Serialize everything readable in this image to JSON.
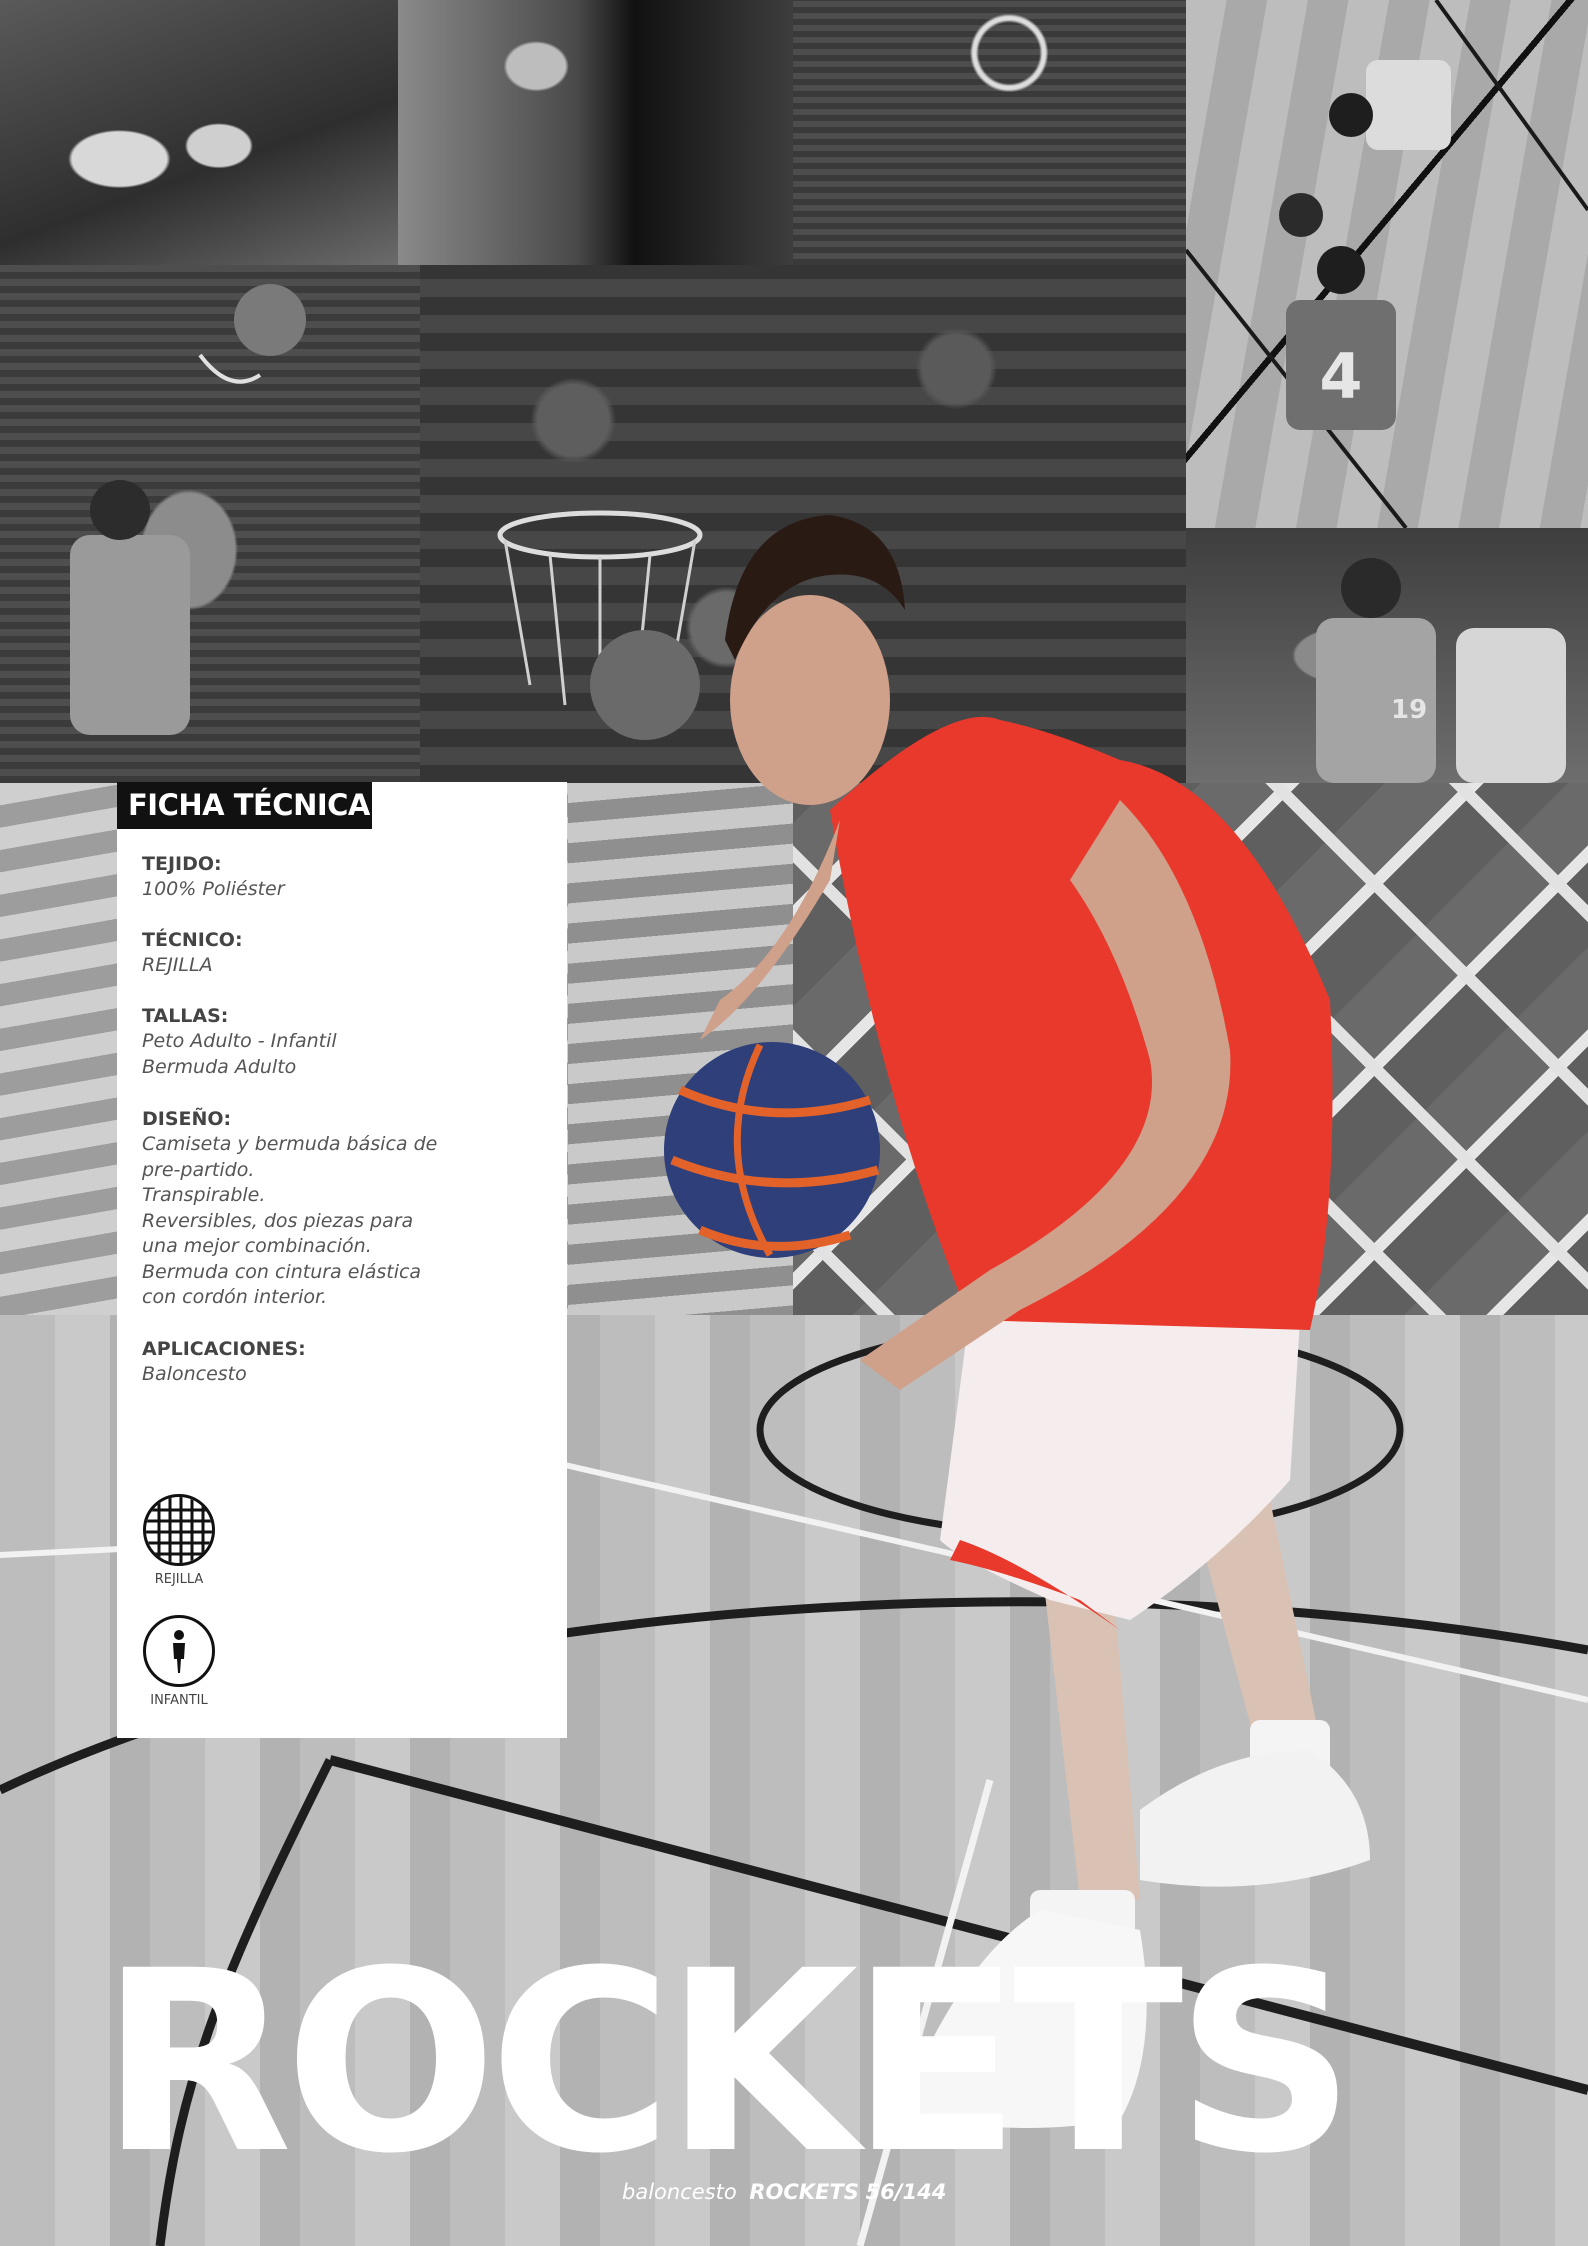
{
  "spec_card": {
    "title": "FICHA TÉCNICA",
    "tejido": {
      "label": "TEJIDO:",
      "value": "100% Poliéster"
    },
    "tecnico": {
      "label": "TÉCNICO:",
      "value": "REJILLA"
    },
    "tallas": {
      "label": "TALLAS:",
      "lines": [
        "Peto Adulto - Infantil",
        "Bermuda Adulto"
      ]
    },
    "diseno": {
      "label": "DISEÑO:",
      "lines": [
        "Camiseta y bermuda básica de",
        "pre-partido.",
        "Transpirable.",
        "Reversibles, dos piezas para",
        "una mejor combinación.",
        "Bermuda con cintura elástica",
        "con cordón interior."
      ]
    },
    "aplicaciones": {
      "label": "APLICACIONES:",
      "value": "Baloncesto"
    },
    "badges": [
      {
        "icon": "mesh-grid-icon",
        "caption": "REJILLA"
      },
      {
        "icon": "child-figure-icon",
        "caption": "INFANTIL"
      }
    ]
  },
  "product_name": "ROCKETS",
  "footer": {
    "section": "baloncesto",
    "product": "ROCKETS",
    "page": "56/144"
  },
  "colors": {
    "jersey": "#e8392c",
    "card_title_bg": "#111111",
    "card_bg": "#ffffff"
  }
}
